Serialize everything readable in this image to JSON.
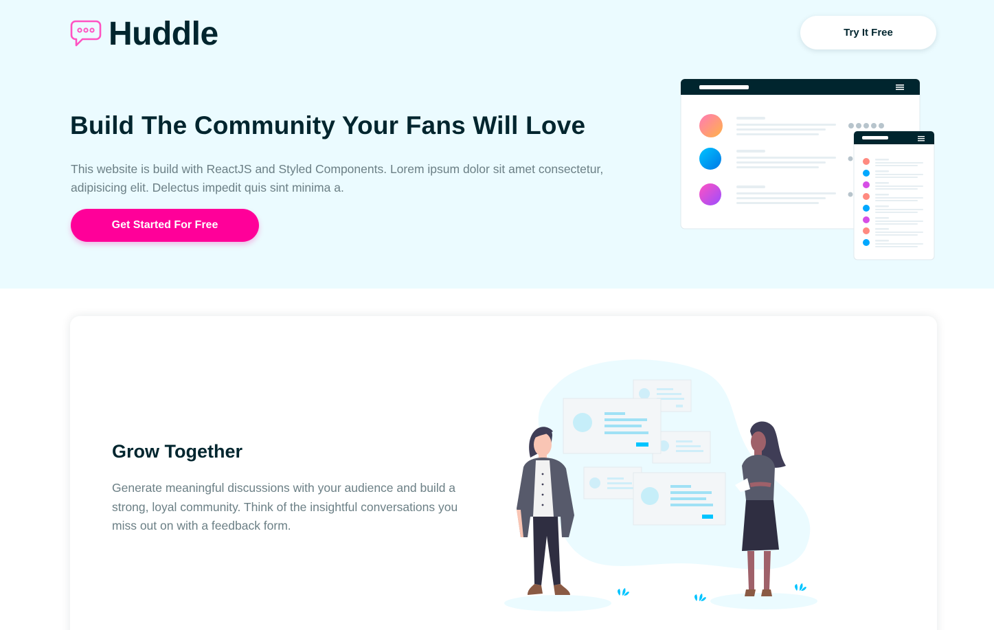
{
  "header": {
    "logo_text": "Huddle",
    "try_button_label": "Try It Free"
  },
  "hero": {
    "title": "Build The Community Your Fans Will Love",
    "description": "This website is build with ReactJS and Styled Components. Lorem ipsum dolor sit amet consectetur, adipisicing elit. Delectus impedit quis sint minima a.",
    "cta_label": "Get Started For Free"
  },
  "feature": {
    "title": "Grow Together",
    "description": "Generate meaningful discussions with your audience and build a strong, loyal community. Think of the insightful conversations you miss out on with a feedback form."
  },
  "icons": {
    "logo": "chat-bubble-icon",
    "menu": "hamburger-menu-icon"
  },
  "colors": {
    "accent": "#ff0099",
    "dark": "#00252e",
    "hero_bg": "#ebfbff",
    "text_muted": "#6b7f85"
  }
}
